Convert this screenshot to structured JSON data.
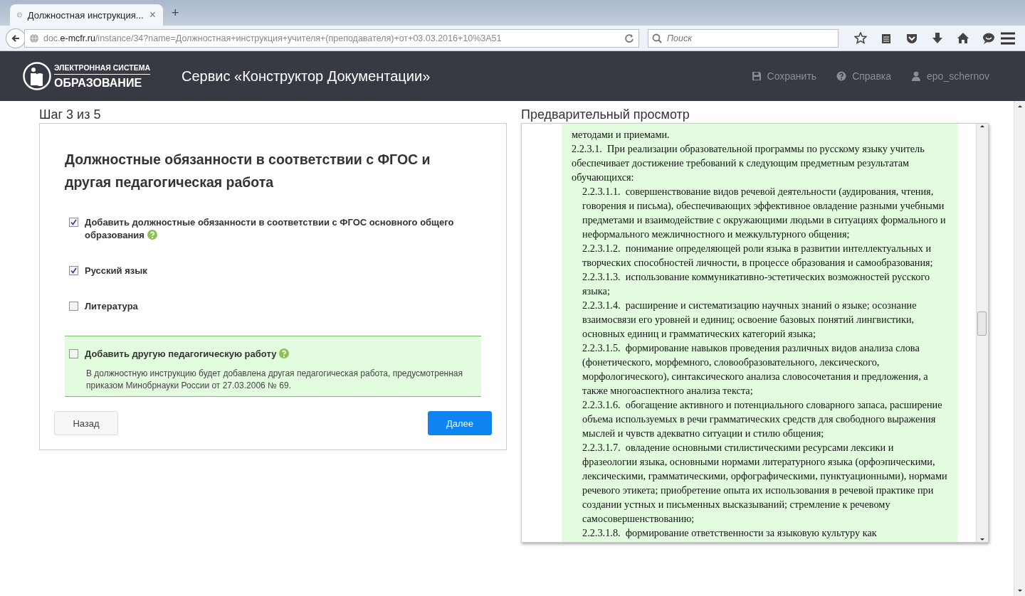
{
  "browser": {
    "tab_title": "Должностная инструкция...",
    "tab_close": "×",
    "new_tab": "+",
    "url_host": "e-mcfr.ru",
    "url_prefix": "doc.",
    "url_path": "/instance/34?name=Должностная+инструкция+учителя+(преподавателя)+от+03.03.2016+10%3A51",
    "search_placeholder": "Поиск"
  },
  "header": {
    "logo_top": "ЭЛЕКТРОННАЯ СИСТЕМА",
    "logo_bottom": "ОБРАЗОВАНИЕ",
    "title": "Сервис «Конструктор Документации»",
    "nav": [
      {
        "kind": "save",
        "label": "Сохранить"
      },
      {
        "kind": "help",
        "label": "Справка"
      },
      {
        "kind": "user",
        "label": "epo_schernov"
      }
    ]
  },
  "step": {
    "label": "Шаг 3 из 5",
    "heading": "Должностные обязанности в соответствии с ФГОС и другая педагогическая работа",
    "options": [
      {
        "label": "Добавить должностные обязанности в соответствии с ФГОС основного общего образования",
        "checked": true,
        "help": true
      },
      {
        "label": "Русский язык",
        "checked": true,
        "help": false
      },
      {
        "label": "Литература",
        "checked": false,
        "help": false
      }
    ],
    "extra": {
      "label": "Добавить другую педагогическую работу",
      "checked": false,
      "help": true,
      "description": "В должностную инструкцию будет добавлена другая педагогическая работа, предусмотренная приказом Минобрнауки России от 27.03.2006 № 69."
    },
    "buttons": [
      {
        "kind": "secondary",
        "label": "Назад"
      },
      {
        "kind": "primary",
        "label": "Далее"
      }
    ]
  },
  "preview": {
    "title": "Предварительный просмотр",
    "items": [
      {
        "text": "методами и приемами."
      },
      {
        "number": "2.2.3.1.",
        "text": "При реализации образовательной программы по русскому языку учитель обеспечивает достижение требований к следующим предметным результатам обучающихся:",
        "children": [
          {
            "number": "2.2.3.1.1.",
            "text": "совершенствование видов речевой деятельности (аудирования, чтения, говорения и письма), обеспечивающих эффективное овладение разными учебными предметами и взаимодействие с окружающими людьми в ситуациях формального и неформального межличностного и межкультурного общения;"
          },
          {
            "number": "2.2.3.1.2.",
            "text": "понимание определяющей роли языка в развитии интеллектуальных и творческих способностей личности, в процессе образования и самообразования;"
          },
          {
            "number": "2.2.3.1.3.",
            "text": "использование коммуникативно-эстетических возможностей русского языка;"
          },
          {
            "number": "2.2.3.1.4.",
            "text": "расширение и систематизацию научных знаний о языке; осознание взаимосвязи его уровней и единиц; освоение базовых понятий лингвистики, основных единиц и грамматических категорий языка;"
          },
          {
            "number": "2.2.3.1.5.",
            "text": "формирование навыков проведения различных видов анализа слова (фонетического, морфемного, словообразовательного, лексического, морфологического), синтаксического анализа словосочетания и предложения, а также многоаспектного анализа текста;"
          },
          {
            "number": "2.2.3.1.6.",
            "text": "обогащение активного и потенциального словарного запаса, расширение объема используемых в речи грамматических средств для свободного выражения мыслей и чувств адекватно ситуации и стилю общения;"
          },
          {
            "number": "2.2.3.1.7.",
            "text": "овладение основными стилистическими ресурсами лексики и фразеологии языка, основными нормами литературного языка (орфоэпическими, лексическими, грамматическими, орфографическими, пунктуационными), нормами речевого этикета; приобретение опыта их использования в речевой практике при создании устных и письменных высказываний; стремление к речевому самосовершенствованию;"
          },
          {
            "number": "2.2.3.1.8.",
            "text": "формирование ответственности за языковую культуру как"
          }
        ]
      }
    ]
  }
}
